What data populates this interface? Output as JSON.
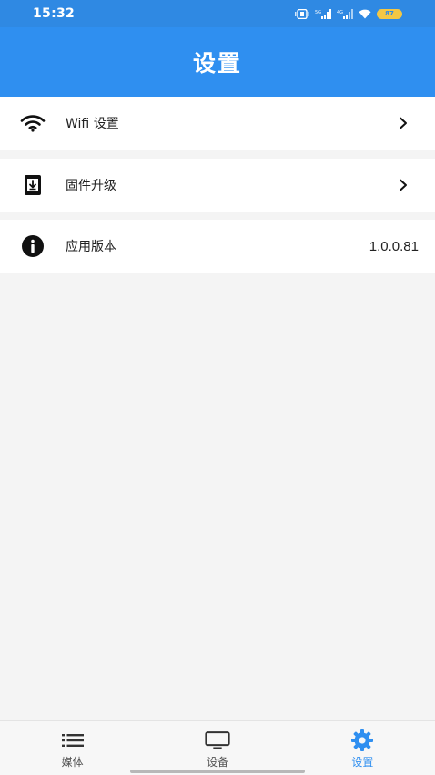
{
  "status_bar": {
    "time": "15:32",
    "battery": "87"
  },
  "header": {
    "title": "设置"
  },
  "settings": {
    "items": [
      {
        "icon": "wifi-icon",
        "label": "Wifi 设置",
        "has_chevron": true
      },
      {
        "icon": "firmware-download-icon",
        "label": "固件升级",
        "has_chevron": true
      },
      {
        "icon": "info-icon",
        "label": "应用版本",
        "value": "1.0.0.81"
      }
    ]
  },
  "bottom_nav": {
    "tabs": [
      {
        "icon": "list-icon",
        "label": "媒体",
        "active": false
      },
      {
        "icon": "monitor-icon",
        "label": "设备",
        "active": false
      },
      {
        "icon": "gear-icon",
        "label": "设置",
        "active": true
      }
    ]
  },
  "colors": {
    "primary": "#2f8ff0",
    "status_bar": "#2f89e3",
    "background": "#f4f4f4",
    "battery": "#f3c744"
  }
}
